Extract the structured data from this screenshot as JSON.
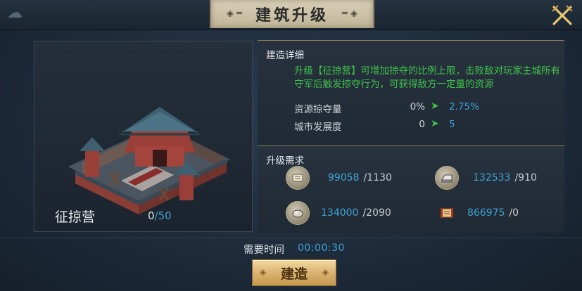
{
  "window": {
    "title": "建筑升级"
  },
  "building": {
    "name": "征掠营",
    "level_current": "0",
    "level_max": "/50"
  },
  "details": {
    "section_title": "建造详细",
    "description": "升级【征掠营】可增加掠夺的比例上限，击败敌对玩家主城所有守军后触发掠夺行为，可获得敌方一定量的资源",
    "stats": [
      {
        "label": "资源掠夺量",
        "current": "0%",
        "next": "2.75%"
      },
      {
        "label": "城市发展度",
        "current": "0",
        "next": "5"
      }
    ]
  },
  "requirements": {
    "section_title": "升级需求",
    "resources": [
      {
        "icon": "scroll-icon",
        "have": "99058",
        "need": "/1130"
      },
      {
        "icon": "iron-ingot-icon",
        "have": "132533",
        "need": "/910"
      },
      {
        "icon": "stone-icon",
        "have": "134000",
        "need": "/2090"
      },
      {
        "icon": "scroll-document-icon",
        "have": "866975",
        "need": "/0"
      }
    ]
  },
  "time": {
    "label": "需要时间",
    "value": "00:00:30"
  },
  "actions": {
    "build_label": "建造"
  },
  "colors": {
    "accent_blue": "#3fa3d6",
    "accent_green": "#3fc24a",
    "button_gold": "#d8b06c"
  }
}
